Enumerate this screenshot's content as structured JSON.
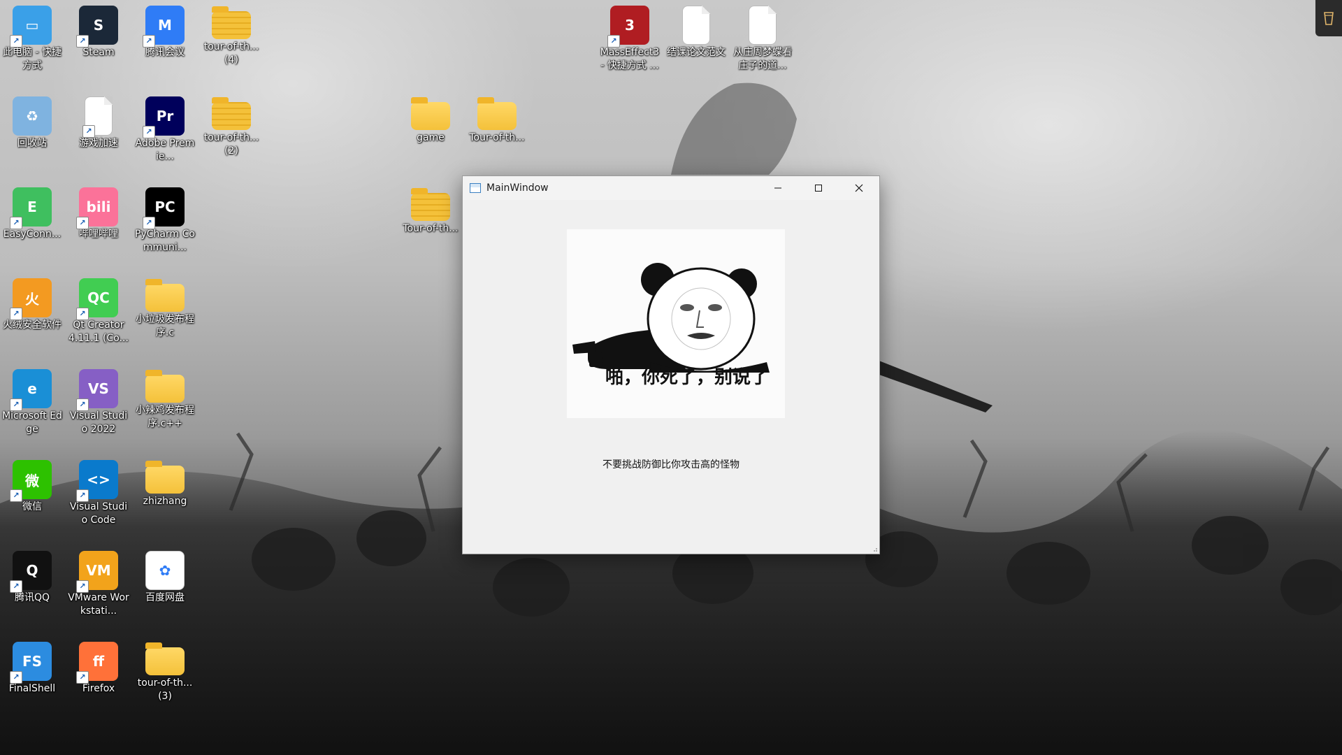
{
  "desktop": {
    "icons": [
      {
        "label": "此电脑 - 快捷方式",
        "icon": "computer-icon",
        "color": "#3aa0e8"
      },
      {
        "label": "Steam",
        "icon": "steam-icon",
        "color": "#1b2838"
      },
      {
        "label": "腾讯会议",
        "icon": "tencent-meeting-icon",
        "color": "#2f7cf6"
      },
      {
        "label": "tour-of-th... (4)",
        "icon": "zip-folder-icon",
        "color": "#f4c13a"
      },
      {
        "label": "回收站",
        "icon": "recycle-bin-icon",
        "color": "#7fb3e0"
      },
      {
        "label": "游戏加速",
        "icon": "document-icon",
        "color": "#ffffff"
      },
      {
        "label": "Adobe Premie...",
        "icon": "premiere-icon",
        "color": "#00005b"
      },
      {
        "label": "tour-of-th... (2)",
        "icon": "zip-folder-icon",
        "color": "#f4c13a"
      },
      {
        "label": "EasyConn...",
        "icon": "easyconnect-icon",
        "color": "#3fbf5f"
      },
      {
        "label": "哔哩哔哩",
        "icon": "bilibili-icon",
        "color": "#fb7299"
      },
      {
        "label": "PyCharm Communi...",
        "icon": "pycharm-icon",
        "color": "#000000"
      },
      {
        "label": "火绒安全软件",
        "icon": "huorong-icon",
        "color": "#f39a21"
      },
      {
        "label": "Qt Creator 4.11.1 (Co...",
        "icon": "qt-creator-icon",
        "color": "#41cd52"
      },
      {
        "label": "小垃圾发布程序.c",
        "icon": "folder-icon",
        "color": "#f4c13a"
      },
      {
        "label": "Microsoft Edge",
        "icon": "edge-icon",
        "color": "#1a8fd6"
      },
      {
        "label": "Visual Studio 2022",
        "icon": "visual-studio-icon",
        "color": "#865fc5"
      },
      {
        "label": "小辣鸡发布程序.c++",
        "icon": "folder-icon",
        "color": "#f4c13a"
      },
      {
        "label": "微信",
        "icon": "wechat-icon",
        "color": "#2dc100"
      },
      {
        "label": "Visual Studio Code",
        "icon": "vscode-icon",
        "color": "#0a7acc"
      },
      {
        "label": "zhizhang",
        "icon": "folder-icon",
        "color": "#f4c13a"
      },
      {
        "label": "腾讯QQ",
        "icon": "qq-icon",
        "color": "#111111"
      },
      {
        "label": "VMware Workstati...",
        "icon": "vmware-icon",
        "color": "#f2a31b"
      },
      {
        "label": "百度网盘",
        "icon": "baidu-netdisk-icon",
        "color": "#ffffff"
      },
      {
        "label": "FinalShell",
        "icon": "finalshell-icon",
        "color": "#2c8ce0"
      },
      {
        "label": "Firefox",
        "icon": "firefox-icon",
        "color": "#ff7139"
      },
      {
        "label": "tour-of-th... (3)",
        "icon": "folder-icon",
        "color": "#f4c13a"
      },
      {
        "label": "MassEffect3 - 快捷方式 ...",
        "icon": "mass-effect-icon",
        "color": "#b01d22"
      },
      {
        "label": "结课论文范文",
        "icon": "document-icon",
        "color": "#ffffff"
      },
      {
        "label": "从庄周梦蝶看庄子的道...",
        "icon": "document-icon",
        "color": "#ffffff"
      },
      {
        "label": "game",
        "icon": "folder-icon",
        "color": "#f4c13a"
      },
      {
        "label": "Tour-of-th...",
        "icon": "folder-icon",
        "color": "#f4c13a"
      },
      {
        "label": "Tour-of-th...",
        "icon": "zip-folder-icon",
        "color": "#f4c13a"
      }
    ]
  },
  "window": {
    "title": "MainWindow",
    "image_caption": "啪，你死了，别说了",
    "label": "不要挑战防御比你攻击高的怪物",
    "controls": [
      "minimize-icon",
      "maximize-icon",
      "close-icon"
    ]
  }
}
